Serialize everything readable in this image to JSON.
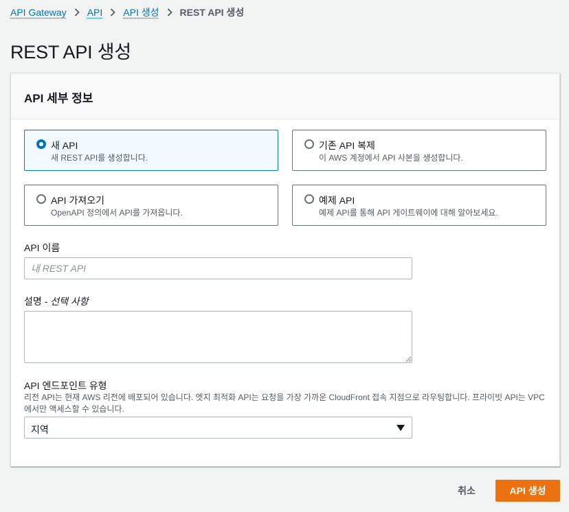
{
  "breadcrumb": {
    "items": [
      "API Gateway",
      "API",
      "API 생성"
    ],
    "current": "REST API 생성"
  },
  "page_title": "REST API 생성",
  "panel": {
    "title": "API 세부 정보",
    "options": [
      {
        "title": "새 API",
        "desc": "새 REST API를 생성합니다.",
        "selected": true
      },
      {
        "title": "기존 API 복제",
        "desc": "이 AWS 계정에서 API 사본을 생성합니다.",
        "selected": false
      },
      {
        "title": "API 가져오기",
        "desc": "OpenAPI 정의에서 API를 가져옵니다.",
        "selected": false
      },
      {
        "title": "예제 API",
        "desc": "예제 API를 통해 API 게이트웨이에 대해 알아보세요.",
        "selected": false
      }
    ],
    "name_field": {
      "label": "API 이름",
      "placeholder": "내 REST API",
      "value": ""
    },
    "description_field": {
      "label": "설명",
      "optional": " - 선택 사항",
      "value": ""
    },
    "endpoint_field": {
      "label": "API 엔드포인트 유형",
      "hint": "리전 API는 현재 AWS 리전에 배포되어 있습니다. 엣지 최적화 API는 요청을 가장 가까운 CloudFront 접속 지점으로 라우팅합니다. 프라이빗 API는 VPC에서만 액세스할 수 있습니다.",
      "selected": "지역"
    }
  },
  "actions": {
    "cancel": "취소",
    "create": "API 생성"
  },
  "colors": {
    "accent": "#0073bb",
    "primary_button": "#ec7211"
  },
  "icons": {
    "breadcrumb_separator": "chevron-right-icon",
    "select_caret": "caret-down-icon"
  }
}
